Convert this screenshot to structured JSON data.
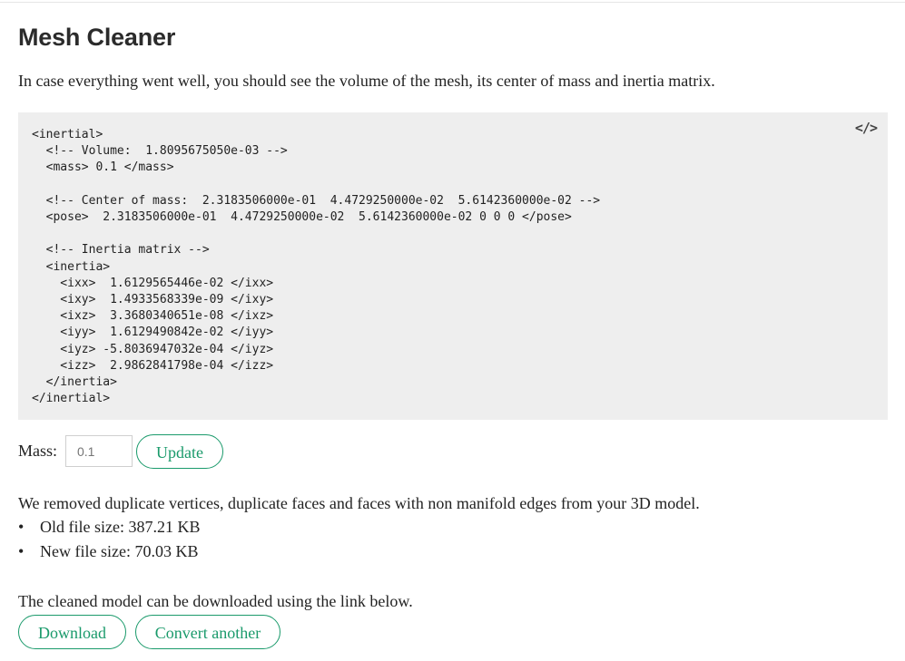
{
  "page": {
    "title": "Mesh Cleaner",
    "intro": "In case everything went well, you should see the volume of the mesh, its center of mass and inertia matrix."
  },
  "code": {
    "icon": "code-icon",
    "lines": [
      "<inertial>",
      "  <!-- Volume:  1.8095675050e-03 -->",
      "  <mass> 0.1 </mass>",
      "",
      "  <!-- Center of mass:  2.3183506000e-01  4.4729250000e-02  5.6142360000e-02 -->",
      "  <pose>  2.3183506000e-01  4.4729250000e-02  5.6142360000e-02 0 0 0 </pose>",
      "",
      "  <!-- Inertia matrix -->",
      "  <inertia>",
      "    <ixx>  1.6129565446e-02 </ixx>",
      "    <ixy>  1.4933568339e-09 </ixy>",
      "    <ixz>  3.3680340651e-08 </ixz>",
      "    <iyy>  1.6129490842e-02 </iyy>",
      "    <iyz> -5.8036947032e-04 </iyz>",
      "    <izz>  2.9862841798e-04 </izz>",
      "  </inertia>",
      "</inertial>"
    ]
  },
  "mass_form": {
    "label": "Mass:",
    "placeholder": "0.1",
    "value": "",
    "update_label": "Update"
  },
  "result": {
    "removed_text": "We removed duplicate vertices, duplicate faces and faces with non manifold edges from your 3D model.",
    "bullet": "•",
    "sizes": [
      "Old file size: 387.21 KB",
      "New file size: 70.03 KB"
    ],
    "cleaned_text": "The cleaned model can be downloaded using the link below.",
    "download_label": "Download",
    "convert_label": "Convert another"
  },
  "colors": {
    "accent": "#1a9a6b",
    "code_background": "#eeeeee"
  }
}
